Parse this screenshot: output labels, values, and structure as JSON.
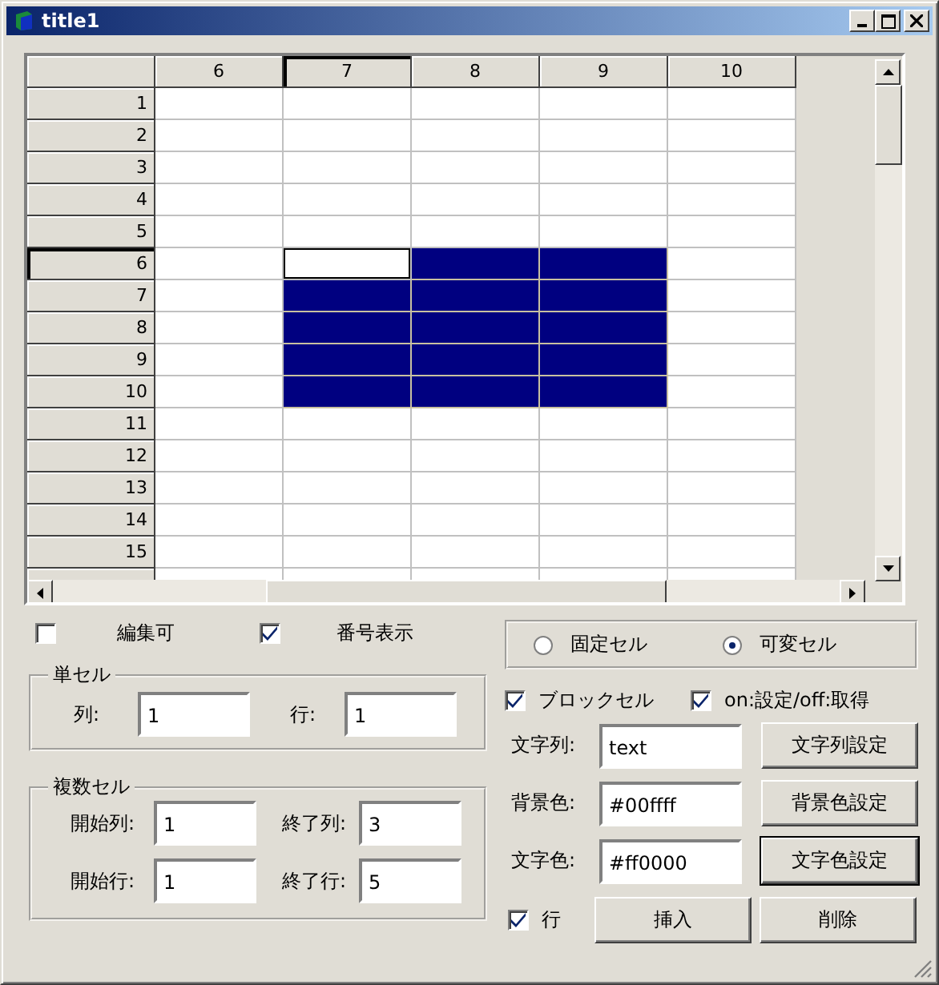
{
  "window": {
    "title": "title1"
  },
  "grid": {
    "columns": [
      {
        "label": "6",
        "current": false
      },
      {
        "label": "7",
        "current": true
      },
      {
        "label": "8",
        "current": false
      },
      {
        "label": "9",
        "current": false
      },
      {
        "label": "10",
        "current": false
      }
    ],
    "rows": [
      {
        "label": "1",
        "current": false,
        "cells": [
          {
            "selected": false,
            "focused": false
          },
          {
            "selected": false,
            "focused": false
          },
          {
            "selected": false,
            "focused": false
          },
          {
            "selected": false,
            "focused": false
          },
          {
            "selected": false,
            "focused": false
          }
        ]
      },
      {
        "label": "2",
        "current": false,
        "cells": [
          {
            "selected": false,
            "focused": false
          },
          {
            "selected": false,
            "focused": false
          },
          {
            "selected": false,
            "focused": false
          },
          {
            "selected": false,
            "focused": false
          },
          {
            "selected": false,
            "focused": false
          }
        ]
      },
      {
        "label": "3",
        "current": false,
        "cells": [
          {
            "selected": false,
            "focused": false
          },
          {
            "selected": false,
            "focused": false
          },
          {
            "selected": false,
            "focused": false
          },
          {
            "selected": false,
            "focused": false
          },
          {
            "selected": false,
            "focused": false
          }
        ]
      },
      {
        "label": "4",
        "current": false,
        "cells": [
          {
            "selected": false,
            "focused": false
          },
          {
            "selected": false,
            "focused": false
          },
          {
            "selected": false,
            "focused": false
          },
          {
            "selected": false,
            "focused": false
          },
          {
            "selected": false,
            "focused": false
          }
        ]
      },
      {
        "label": "5",
        "current": false,
        "cells": [
          {
            "selected": false,
            "focused": false
          },
          {
            "selected": false,
            "focused": false
          },
          {
            "selected": false,
            "focused": false
          },
          {
            "selected": false,
            "focused": false
          },
          {
            "selected": false,
            "focused": false
          }
        ]
      },
      {
        "label": "6",
        "current": true,
        "cells": [
          {
            "selected": false,
            "focused": false
          },
          {
            "selected": false,
            "focused": true
          },
          {
            "selected": true,
            "focused": false
          },
          {
            "selected": true,
            "focused": false
          },
          {
            "selected": false,
            "focused": false
          }
        ]
      },
      {
        "label": "7",
        "current": false,
        "cells": [
          {
            "selected": false,
            "focused": false
          },
          {
            "selected": true,
            "focused": false
          },
          {
            "selected": true,
            "focused": false
          },
          {
            "selected": true,
            "focused": false
          },
          {
            "selected": false,
            "focused": false
          }
        ]
      },
      {
        "label": "8",
        "current": false,
        "cells": [
          {
            "selected": false,
            "focused": false
          },
          {
            "selected": true,
            "focused": false
          },
          {
            "selected": true,
            "focused": false
          },
          {
            "selected": true,
            "focused": false
          },
          {
            "selected": false,
            "focused": false
          }
        ]
      },
      {
        "label": "9",
        "current": false,
        "cells": [
          {
            "selected": false,
            "focused": false
          },
          {
            "selected": true,
            "focused": false
          },
          {
            "selected": true,
            "focused": false
          },
          {
            "selected": true,
            "focused": false
          },
          {
            "selected": false,
            "focused": false
          }
        ]
      },
      {
        "label": "10",
        "current": false,
        "cells": [
          {
            "selected": false,
            "focused": false
          },
          {
            "selected": true,
            "focused": false
          },
          {
            "selected": true,
            "focused": false
          },
          {
            "selected": true,
            "focused": false
          },
          {
            "selected": false,
            "focused": false
          }
        ]
      },
      {
        "label": "11",
        "current": false,
        "cells": [
          {
            "selected": false,
            "focused": false
          },
          {
            "selected": false,
            "focused": false
          },
          {
            "selected": false,
            "focused": false
          },
          {
            "selected": false,
            "focused": false
          },
          {
            "selected": false,
            "focused": false
          }
        ]
      },
      {
        "label": "12",
        "current": false,
        "cells": [
          {
            "selected": false,
            "focused": false
          },
          {
            "selected": false,
            "focused": false
          },
          {
            "selected": false,
            "focused": false
          },
          {
            "selected": false,
            "focused": false
          },
          {
            "selected": false,
            "focused": false
          }
        ]
      },
      {
        "label": "13",
        "current": false,
        "cells": [
          {
            "selected": false,
            "focused": false
          },
          {
            "selected": false,
            "focused": false
          },
          {
            "selected": false,
            "focused": false
          },
          {
            "selected": false,
            "focused": false
          },
          {
            "selected": false,
            "focused": false
          }
        ]
      },
      {
        "label": "14",
        "current": false,
        "cells": [
          {
            "selected": false,
            "focused": false
          },
          {
            "selected": false,
            "focused": false
          },
          {
            "selected": false,
            "focused": false
          },
          {
            "selected": false,
            "focused": false
          },
          {
            "selected": false,
            "focused": false
          }
        ]
      },
      {
        "label": "15",
        "current": false,
        "cells": [
          {
            "selected": false,
            "focused": false
          },
          {
            "selected": false,
            "focused": false
          },
          {
            "selected": false,
            "focused": false
          },
          {
            "selected": false,
            "focused": false
          },
          {
            "selected": false,
            "focused": false
          }
        ]
      }
    ]
  },
  "options": [
    {
      "label": "編集可",
      "checked": false
    },
    {
      "label": "番号表示",
      "checked": true
    }
  ],
  "single_cell": {
    "title": "単セル",
    "fields": [
      {
        "label": "列:",
        "value": "1"
      },
      {
        "label": "行:",
        "value": "1"
      }
    ]
  },
  "multi_cell": {
    "title": "複数セル",
    "fields": [
      {
        "label": "開始列:",
        "value": "1"
      },
      {
        "label": "終了列:",
        "value": "3"
      },
      {
        "label": "開始行:",
        "value": "1"
      },
      {
        "label": "終了行:",
        "value": "5"
      }
    ]
  },
  "cell_type": [
    {
      "label": "固定セル",
      "selected": false
    },
    {
      "label": "可変セル",
      "selected": true
    }
  ],
  "modes": [
    {
      "label": "ブロックセル",
      "checked": true
    },
    {
      "label": "on:設定/off:取得",
      "checked": true
    }
  ],
  "properties": [
    {
      "label": "文字列:",
      "value": "text",
      "button": "文字列設定",
      "default": false
    },
    {
      "label": "背景色:",
      "value": "#00ffff",
      "button": "背景色設定",
      "default": false
    },
    {
      "label": "文字色:",
      "value": "#ff0000",
      "button": "文字色設定",
      "default": true
    }
  ],
  "row_ops": {
    "label": "行",
    "checked": true,
    "buttons": [
      "挿入",
      "削除"
    ]
  }
}
